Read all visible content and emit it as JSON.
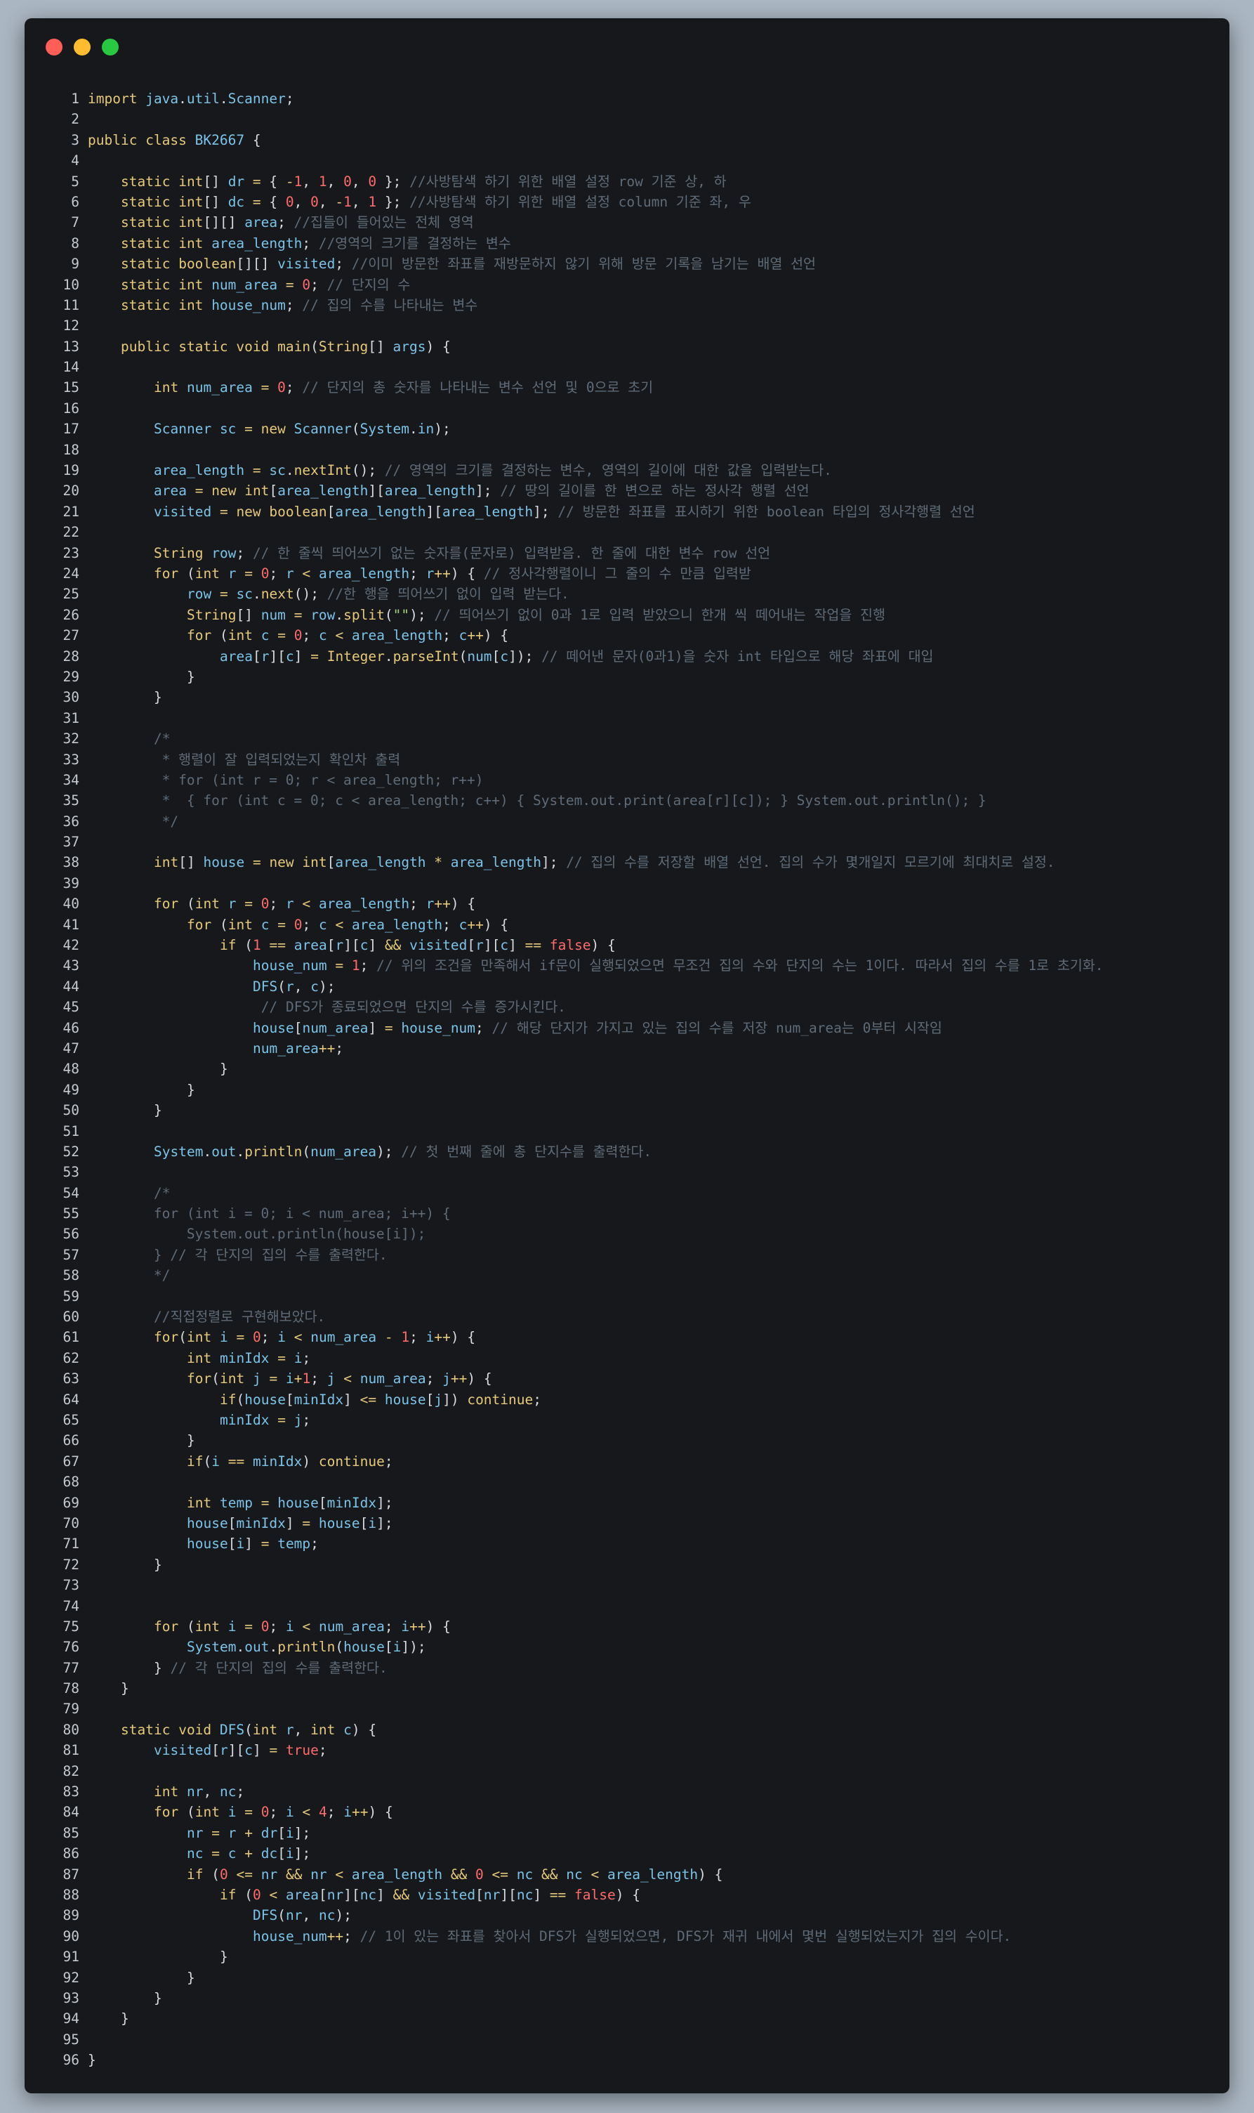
{
  "window": {
    "controls": [
      "close",
      "minimize",
      "maximize"
    ]
  },
  "editor": {
    "language": "java",
    "lines": [
      "import java.util.Scanner;",
      "",
      "public class BK2667 {",
      "",
      "    static int[] dr = { -1, 1, 0, 0 }; //사방탐색 하기 위한 배열 설정 row 기준 상, 하",
      "    static int[] dc = { 0, 0, -1, 1 }; //사방탐색 하기 위한 배열 설정 column 기준 좌, 우",
      "    static int[][] area; //집들이 들어있는 전체 영역",
      "    static int area_length; //영역의 크기를 결정하는 변수",
      "    static boolean[][] visited; //이미 방문한 좌표를 재방문하지 않기 위해 방문 기록을 남기는 배열 선언",
      "    static int num_area = 0; // 단지의 수",
      "    static int house_num; // 집의 수를 나타내는 변수",
      "",
      "    public static void main(String[] args) {",
      "",
      "        int num_area = 0; // 단지의 총 숫자를 나타내는 변수 선언 및 0으로 초기",
      "",
      "        Scanner sc = new Scanner(System.in);",
      "",
      "        area_length = sc.nextInt(); // 영역의 크기를 결정하는 변수, 영역의 길이에 대한 값을 입력받는다.",
      "        area = new int[area_length][area_length]; // 땅의 길이를 한 변으로 하는 정사각 행렬 선언",
      "        visited = new boolean[area_length][area_length]; // 방문한 좌표를 표시하기 위한 boolean 타입의 정사각행렬 선언",
      "",
      "        String row; // 한 줄씩 띄어쓰기 없는 숫자를(문자로) 입력받음. 한 줄에 대한 변수 row 선언",
      "        for (int r = 0; r < area_length; r++) { // 정사각행렬이니 그 줄의 수 만큼 입력받",
      "            row = sc.next(); //한 행을 띄어쓰기 없이 입력 받는다.",
      "            String[] num = row.split(\"\"); // 띄어쓰기 없이 0과 1로 입력 받았으니 한개 씩 떼어내는 작업을 진행",
      "            for (int c = 0; c < area_length; c++) {",
      "                area[r][c] = Integer.parseInt(num[c]); // 떼어낸 문자(0과1)을 숫자 int 타입으로 해당 좌표에 대입",
      "            }",
      "        }",
      "",
      "        /*",
      "         * 행렬이 잘 입력되었는지 확인차 출력",
      "         * for (int r = 0; r < area_length; r++)",
      "         *  { for (int c = 0; c < area_length; c++) { System.out.print(area[r][c]); } System.out.println(); }",
      "         */",
      "",
      "        int[] house = new int[area_length * area_length]; // 집의 수를 저장할 배열 선언. 집의 수가 몇개일지 모르기에 최대치로 설정.",
      "",
      "        for (int r = 0; r < area_length; r++) {",
      "            for (int c = 0; c < area_length; c++) {",
      "                if (1 == area[r][c] && visited[r][c] == false) {",
      "                    house_num = 1; // 위의 조건을 만족해서 if문이 실행되었으면 무조건 집의 수와 단지의 수는 1이다. 따라서 집의 수를 1로 초기화.",
      "                    DFS(r, c);",
      "                     // DFS가 종료되었으면 단지의 수를 증가시킨다.",
      "                    house[num_area] = house_num; // 해당 단지가 가지고 있는 집의 수를 저장 num_area는 0부터 시작임",
      "                    num_area++;",
      "                }",
      "            }",
      "        }",
      "",
      "        System.out.println(num_area); // 첫 번째 줄에 총 단지수를 출력한다.",
      "",
      "        /*",
      "        for (int i = 0; i < num_area; i++) {",
      "            System.out.println(house[i]);",
      "        } // 각 단지의 집의 수를 출력한다.",
      "        */",
      "",
      "        //직접정렬로 구현해보았다.",
      "        for(int i = 0; i < num_area - 1; i++) {",
      "            int minIdx = i;",
      "            for(int j = i+1; j < num_area; j++) {",
      "                if(house[minIdx] <= house[j]) continue;",
      "                minIdx = j;",
      "            }",
      "            if(i == minIdx) continue;",
      "",
      "            int temp = house[minIdx];",
      "            house[minIdx] = house[i];",
      "            house[i] = temp;",
      "        }",
      "",
      "",
      "        for (int i = 0; i < num_area; i++) {",
      "            System.out.println(house[i]);",
      "        } // 각 단지의 집의 수를 출력한다.",
      "    }",
      "",
      "    static void DFS(int r, int c) {",
      "        visited[r][c] = true;",
      "",
      "        int nr, nc;",
      "        for (int i = 0; i < 4; i++) {",
      "            nr = r + dr[i];",
      "            nc = c + dc[i];",
      "            if (0 <= nr && nr < area_length && 0 <= nc && nc < area_length) {",
      "                if (0 < area[nr][nc] && visited[nr][nc] == false) {",
      "                    DFS(nr, nc);",
      "                    house_num++; // 1이 있는 좌표를 찾아서 DFS가 실행되었으면, DFS가 재귀 내에서 몇번 실행되었는지가 집의 수이다.",
      "                }",
      "            }",
      "        }",
      "    }",
      "",
      "}"
    ]
  }
}
